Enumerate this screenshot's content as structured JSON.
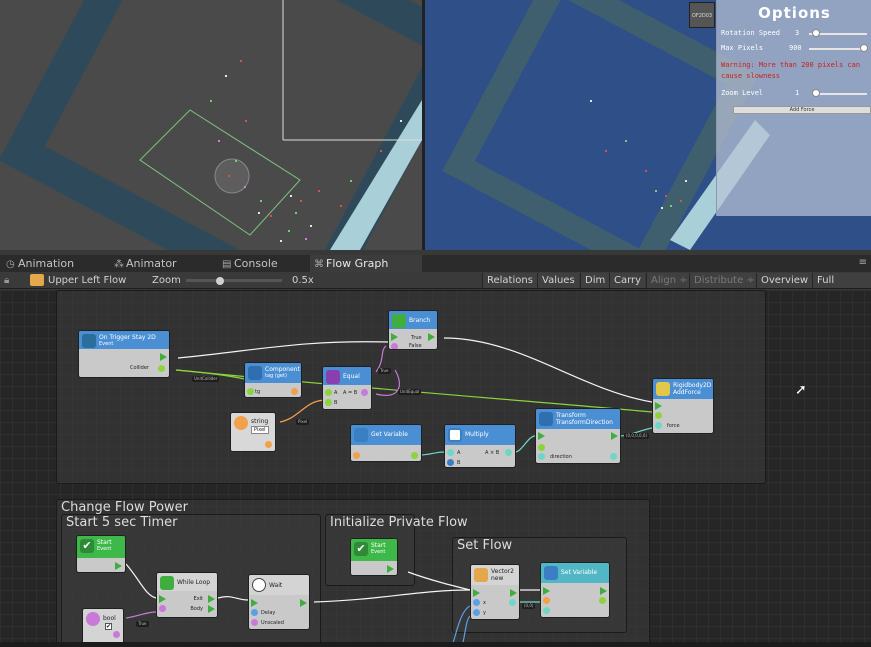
{
  "scene": {
    "badge": "OF2D03"
  },
  "options_panel": {
    "title": "Options",
    "rotation_speed_label": "Rotation Speed",
    "rotation_speed_value": "3",
    "rotation_speed_fraction": 0.12,
    "max_pixels_label": "Max Pixels",
    "max_pixels_value": "900",
    "max_pixels_fraction": 0.95,
    "warning": "Warning: More than 200 pixels can cause slowness",
    "zoom_level_label": "Zoom Level",
    "zoom_level_value": "1",
    "zoom_level_fraction": 0.05,
    "add_force_label": "Add Force"
  },
  "tabs": [
    {
      "label": "Animation",
      "icon": "animation-icon"
    },
    {
      "label": "Animator",
      "icon": "animator-icon"
    },
    {
      "label": "Console",
      "icon": "console-icon"
    },
    {
      "label": "Flow Graph",
      "icon": "flow-graph-icon",
      "active": true
    }
  ],
  "toolbar": {
    "graph_name": "Upper Left Flow",
    "zoom_label": "Zoom",
    "zoom_value": "0.5x",
    "zoom_fraction": 0.35,
    "buttons": [
      "Relations",
      "Values",
      "Dim",
      "Carry",
      "Align ÷",
      "Distribute ÷",
      "Overview",
      "Full Screen"
    ]
  },
  "graph": {
    "groups": {
      "change_flow_power": "Change Flow Power",
      "start_timer": "Start 5 sec Timer",
      "init_private": "Initialize Private Flow",
      "set_flow": "Set Flow"
    },
    "nodes": {
      "on_trigger": {
        "title": "On Trigger Stay 2D",
        "sub": "Event",
        "port": "Collider"
      },
      "branch": {
        "title": "Branch",
        "true_label": "True",
        "false_label": "False"
      },
      "component": {
        "title": "Component",
        "sub": "tag (get)",
        "port": "tg"
      },
      "equal": {
        "title": "Equal",
        "a_label": "A",
        "eq_label": "A = B",
        "b_label": "B"
      },
      "string": {
        "title": "string",
        "value": "Pixel"
      },
      "get_variable": {
        "title": "Get Variable"
      },
      "multiply": {
        "title": "Multiply",
        "a_label": "A",
        "ab_label": "A × B",
        "b_label": "B"
      },
      "transform": {
        "title": "Transform",
        "sub": "TransformDirection",
        "port": "direction"
      },
      "rigidbody": {
        "title": "Rigidbody2D",
        "sub": "AddForce",
        "port": "force"
      },
      "start1": {
        "title": "Start",
        "sub": "Event"
      },
      "while_loop": {
        "title": "While Loop",
        "exit": "Exit",
        "body": "Body"
      },
      "wait": {
        "title": "Wait",
        "delay": "Delay",
        "unscaled": "Unscaled"
      },
      "bool": {
        "title": "bool"
      },
      "start2": {
        "title": "Start",
        "sub": "Event"
      },
      "vector2": {
        "title": "Vector2",
        "sub": "new",
        "x": "x",
        "y": "y"
      },
      "set_variable": {
        "title": "Set Variable"
      }
    },
    "tags": {
      "collider_tag": "UnitCollider",
      "equal_tag": "UnitEqual",
      "pixel_tag": "Pixel",
      "eq_out_tag": "True",
      "vec_tag": "(0,0,0,0,0)",
      "bool_tag": "True",
      "vec2_tag": "(0,0)"
    }
  },
  "colors": {
    "node_blue": "#4a8fd4",
    "node_green": "#3fb84a",
    "node_teal": "#52b7c4",
    "flow_green": "#3fae3f",
    "port_green": "#8cd43c",
    "port_orange": "#f2a04a",
    "port_purple": "#c77ad8",
    "port_teal": "#6ed6c4",
    "port_blue": "#5aa0e6"
  }
}
